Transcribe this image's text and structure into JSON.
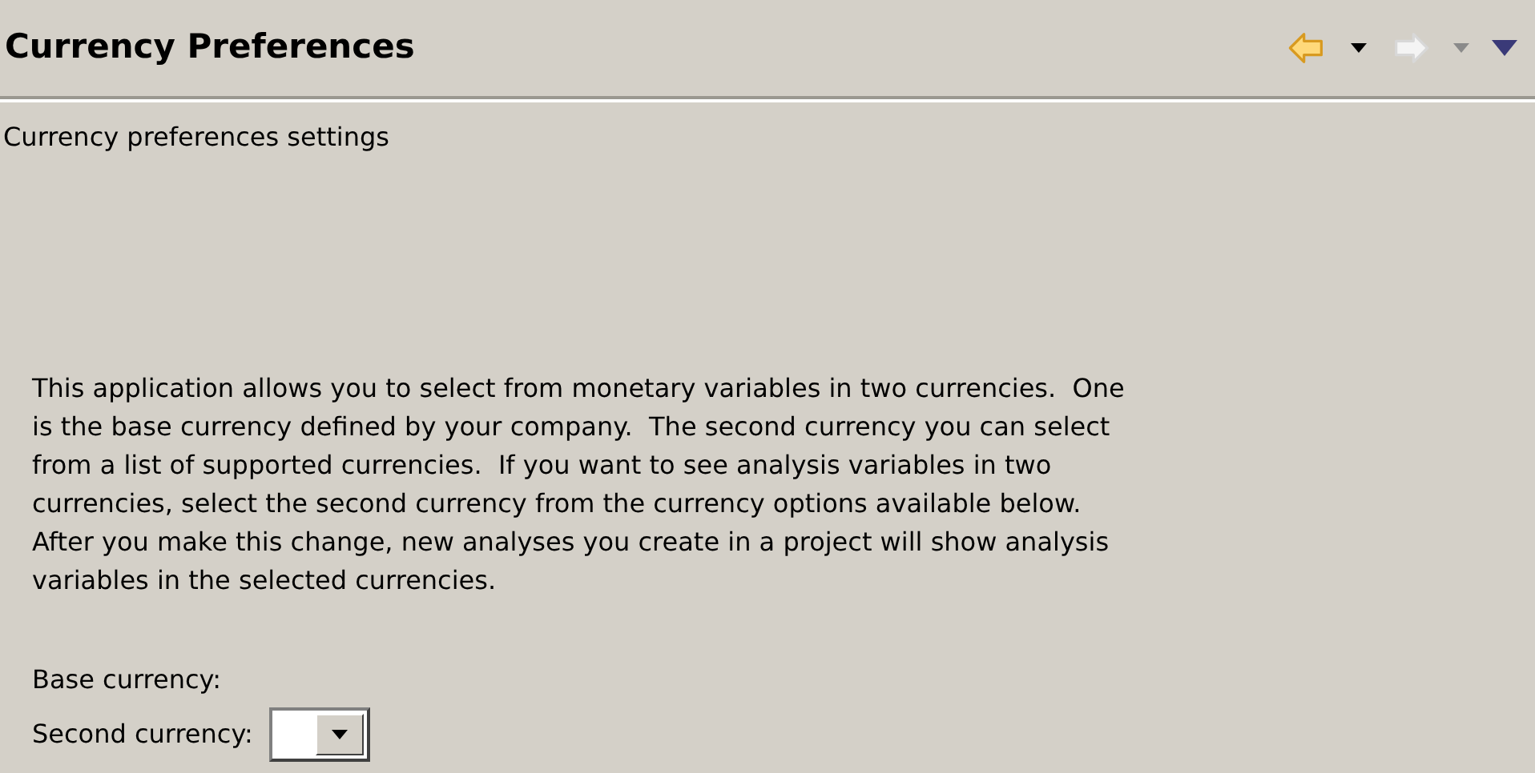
{
  "header": {
    "title": "Currency Preferences",
    "nav": [
      {
        "kind": "back",
        "disabled": false
      },
      {
        "kind": "back-menu",
        "disabled": false
      },
      {
        "kind": "forward",
        "disabled": true
      },
      {
        "kind": "forward-menu",
        "disabled": true
      },
      {
        "kind": "view-menu",
        "disabled": false
      }
    ]
  },
  "subtitle": "Currency preferences settings",
  "description_lines": [
    "This application allows you to select from monetary variables in two currencies.  One",
    "is the base currency defined by your company.  The second currency you can select",
    "from a list of supported currencies.  If you want to see analysis variables in two",
    "currencies, select the second currency from the currency options available below.",
    "After you make this change, new analyses you create in a project will show analysis",
    "variables in the selected currencies."
  ],
  "fields": [
    {
      "kind": "label",
      "label": "Base currency:"
    },
    {
      "kind": "combo",
      "label": "Second currency:"
    }
  ]
}
